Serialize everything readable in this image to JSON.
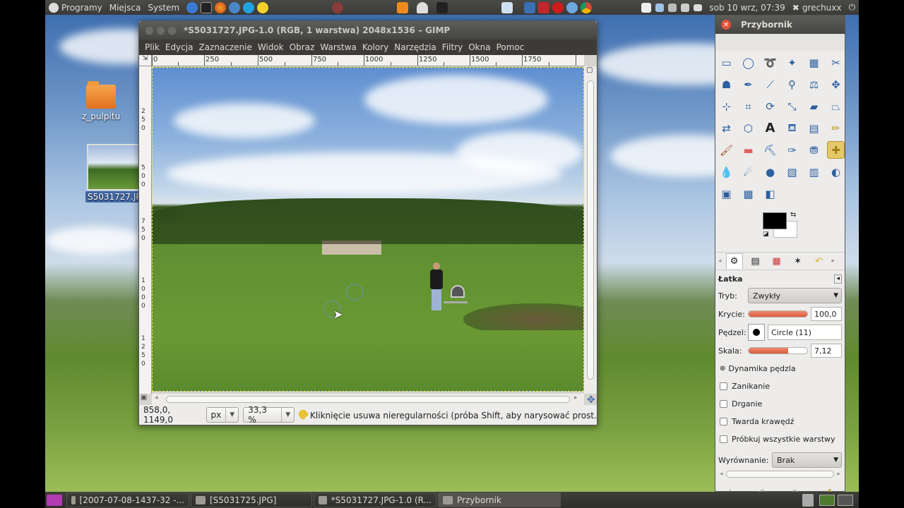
{
  "top_panel": {
    "menus": [
      "Programy",
      "Miejsca",
      "System"
    ],
    "clock": "sob 10 wrz, 07:39",
    "user": "grechuxx",
    "icons": [
      "ubuntu-logo-icon",
      "help-icon",
      "terminal-icon",
      "firefox-icon",
      "thunderbird-icon",
      "skype-icon",
      "weather-icon",
      "gimp-icon",
      "vlc-icon",
      "ghost-icon",
      "ink-icon",
      "dropbox-icon",
      "browser-icon",
      "filezilla-icon",
      "opera-icon",
      "pinwheel-icon",
      "chrome-icon",
      "window-icon",
      "network-icon",
      "wifi-icon",
      "volume-icon",
      "mail-icon",
      "power-icon"
    ]
  },
  "desktop": {
    "icons": [
      {
        "label": "z_pulpitu",
        "type": "folder-icon"
      },
      {
        "label": "S5031727.JPG",
        "type": "image-thumbnail"
      }
    ]
  },
  "gimp_window": {
    "title": "*S5031727.JPG-1.0 (RGB, 1 warstwa) 2048x1536 – GIMP",
    "menus": [
      "Plik",
      "Edycja",
      "Zaznaczenie",
      "Widok",
      "Obraz",
      "Warstwa",
      "Kolory",
      "Narzędzia",
      "Filtry",
      "Okna",
      "Pomoc"
    ],
    "ruler_labels": [
      "0",
      "250",
      "500",
      "750",
      "1000",
      "1250",
      "1500",
      "1750"
    ],
    "vruler_labels": [
      "2",
      "5",
      "0",
      "5",
      "0",
      "0",
      "7",
      "5",
      "0",
      "1",
      "0",
      "0",
      "0",
      "1",
      "2",
      "5",
      "0"
    ],
    "status": {
      "coords": "858,0, 1149,0",
      "unit": "px",
      "zoom": "33,3 %",
      "message": "Kliknięcie usuwa nieregularności (próba Shift, aby narysować prost..."
    }
  },
  "toolbox": {
    "title": "Przybornik",
    "tool_options_title": "Łatka",
    "mode_label": "Tryb:",
    "mode_value": "Zwykły",
    "opacity_label": "Krycie:",
    "opacity_value": "100,0",
    "opacity_fraction": 1.0,
    "brush_label": "Pędzel:",
    "brush_value": "Circle (11)",
    "scale_label": "Skala:",
    "scale_value": "7,12",
    "scale_fraction": 0.68,
    "dynamics_label": "Dynamika pędzla",
    "checkboxes": [
      "Zanikanie",
      "Drganie",
      "Twarda krawędź",
      "Próbkuj wszystkie warstwy"
    ],
    "alignment_label": "Wyrównanie:",
    "alignment_value": "Brak",
    "active_tool": "heal-tool",
    "tools": [
      "rect-select-icon",
      "ellipse-select-icon",
      "lasso-icon",
      "fuzzy-select-icon",
      "color-select-icon",
      "scissors-icon",
      "foreground-select-icon",
      "paths-icon",
      "color-picker-icon",
      "zoom-icon",
      "measure-icon",
      "move-icon",
      "align-icon",
      "crop-icon",
      "rotate-icon",
      "scale-icon",
      "shear-icon",
      "perspective-icon",
      "flip-icon",
      "cage-icon",
      "text-icon",
      "bucket-fill-icon",
      "blend-icon",
      "pencil-icon",
      "paintbrush-icon",
      "eraser-icon",
      "airbrush-icon",
      "ink-icon",
      "clone-icon",
      "heal-icon",
      "smudge-icon",
      "dodge-burn-icon",
      "blur-icon",
      "perspective-clone-icon",
      "levels-icon",
      "curves-icon",
      "threshold-icon",
      "color-balance-icon",
      "hue-saturation-icon",
      "brightness-icon"
    ]
  },
  "taskbar": {
    "tasks": [
      {
        "label": "[2007-07-08-1437-32 -...",
        "active": false
      },
      {
        "label": "[S5031725.JPG]",
        "active": false
      },
      {
        "label": "*S5031727.JPG-1.0 (R...",
        "active": false
      },
      {
        "label": "Przybornik",
        "active": true
      }
    ]
  },
  "colors": {
    "panel": "#3c3b37",
    "accent": "#e2523a",
    "slider_fill": "#d85c3c"
  }
}
